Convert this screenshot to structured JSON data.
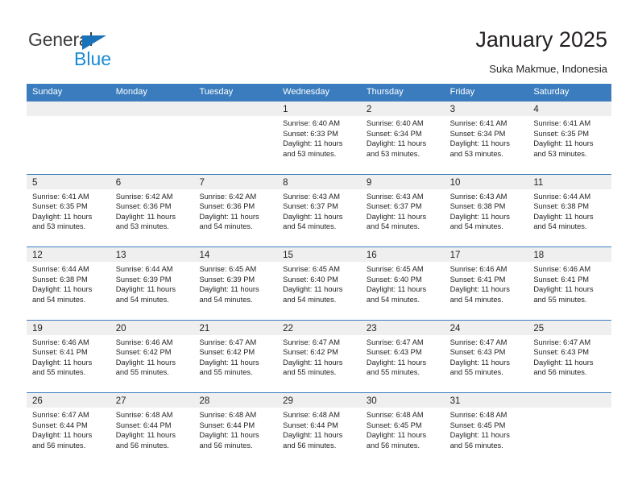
{
  "brand": {
    "name_top": "General",
    "name_bottom": "Blue"
  },
  "header": {
    "title": "January 2025",
    "subtitle": "Suka Makmue, Indonesia"
  },
  "colors": {
    "header_blue": "#3a7cbd",
    "brand_blue": "#1a8ad4",
    "day_band_gray": "#efefef",
    "text": "#231f20"
  },
  "weekdays": [
    "Sunday",
    "Monday",
    "Tuesday",
    "Wednesday",
    "Thursday",
    "Friday",
    "Saturday"
  ],
  "weeks": [
    [
      {
        "day": "",
        "sunrise": "",
        "sunset": "",
        "daylight_line1": "",
        "daylight_line2": ""
      },
      {
        "day": "",
        "sunrise": "",
        "sunset": "",
        "daylight_line1": "",
        "daylight_line2": ""
      },
      {
        "day": "",
        "sunrise": "",
        "sunset": "",
        "daylight_line1": "",
        "daylight_line2": ""
      },
      {
        "day": "1",
        "sunrise": "Sunrise: 6:40 AM",
        "sunset": "Sunset: 6:33 PM",
        "daylight_line1": "Daylight: 11 hours",
        "daylight_line2": "and 53 minutes."
      },
      {
        "day": "2",
        "sunrise": "Sunrise: 6:40 AM",
        "sunset": "Sunset: 6:34 PM",
        "daylight_line1": "Daylight: 11 hours",
        "daylight_line2": "and 53 minutes."
      },
      {
        "day": "3",
        "sunrise": "Sunrise: 6:41 AM",
        "sunset": "Sunset: 6:34 PM",
        "daylight_line1": "Daylight: 11 hours",
        "daylight_line2": "and 53 minutes."
      },
      {
        "day": "4",
        "sunrise": "Sunrise: 6:41 AM",
        "sunset": "Sunset: 6:35 PM",
        "daylight_line1": "Daylight: 11 hours",
        "daylight_line2": "and 53 minutes."
      }
    ],
    [
      {
        "day": "5",
        "sunrise": "Sunrise: 6:41 AM",
        "sunset": "Sunset: 6:35 PM",
        "daylight_line1": "Daylight: 11 hours",
        "daylight_line2": "and 53 minutes."
      },
      {
        "day": "6",
        "sunrise": "Sunrise: 6:42 AM",
        "sunset": "Sunset: 6:36 PM",
        "daylight_line1": "Daylight: 11 hours",
        "daylight_line2": "and 53 minutes."
      },
      {
        "day": "7",
        "sunrise": "Sunrise: 6:42 AM",
        "sunset": "Sunset: 6:36 PM",
        "daylight_line1": "Daylight: 11 hours",
        "daylight_line2": "and 54 minutes."
      },
      {
        "day": "8",
        "sunrise": "Sunrise: 6:43 AM",
        "sunset": "Sunset: 6:37 PM",
        "daylight_line1": "Daylight: 11 hours",
        "daylight_line2": "and 54 minutes."
      },
      {
        "day": "9",
        "sunrise": "Sunrise: 6:43 AM",
        "sunset": "Sunset: 6:37 PM",
        "daylight_line1": "Daylight: 11 hours",
        "daylight_line2": "and 54 minutes."
      },
      {
        "day": "10",
        "sunrise": "Sunrise: 6:43 AM",
        "sunset": "Sunset: 6:38 PM",
        "daylight_line1": "Daylight: 11 hours",
        "daylight_line2": "and 54 minutes."
      },
      {
        "day": "11",
        "sunrise": "Sunrise: 6:44 AM",
        "sunset": "Sunset: 6:38 PM",
        "daylight_line1": "Daylight: 11 hours",
        "daylight_line2": "and 54 minutes."
      }
    ],
    [
      {
        "day": "12",
        "sunrise": "Sunrise: 6:44 AM",
        "sunset": "Sunset: 6:38 PM",
        "daylight_line1": "Daylight: 11 hours",
        "daylight_line2": "and 54 minutes."
      },
      {
        "day": "13",
        "sunrise": "Sunrise: 6:44 AM",
        "sunset": "Sunset: 6:39 PM",
        "daylight_line1": "Daylight: 11 hours",
        "daylight_line2": "and 54 minutes."
      },
      {
        "day": "14",
        "sunrise": "Sunrise: 6:45 AM",
        "sunset": "Sunset: 6:39 PM",
        "daylight_line1": "Daylight: 11 hours",
        "daylight_line2": "and 54 minutes."
      },
      {
        "day": "15",
        "sunrise": "Sunrise: 6:45 AM",
        "sunset": "Sunset: 6:40 PM",
        "daylight_line1": "Daylight: 11 hours",
        "daylight_line2": "and 54 minutes."
      },
      {
        "day": "16",
        "sunrise": "Sunrise: 6:45 AM",
        "sunset": "Sunset: 6:40 PM",
        "daylight_line1": "Daylight: 11 hours",
        "daylight_line2": "and 54 minutes."
      },
      {
        "day": "17",
        "sunrise": "Sunrise: 6:46 AM",
        "sunset": "Sunset: 6:41 PM",
        "daylight_line1": "Daylight: 11 hours",
        "daylight_line2": "and 54 minutes."
      },
      {
        "day": "18",
        "sunrise": "Sunrise: 6:46 AM",
        "sunset": "Sunset: 6:41 PM",
        "daylight_line1": "Daylight: 11 hours",
        "daylight_line2": "and 55 minutes."
      }
    ],
    [
      {
        "day": "19",
        "sunrise": "Sunrise: 6:46 AM",
        "sunset": "Sunset: 6:41 PM",
        "daylight_line1": "Daylight: 11 hours",
        "daylight_line2": "and 55 minutes."
      },
      {
        "day": "20",
        "sunrise": "Sunrise: 6:46 AM",
        "sunset": "Sunset: 6:42 PM",
        "daylight_line1": "Daylight: 11 hours",
        "daylight_line2": "and 55 minutes."
      },
      {
        "day": "21",
        "sunrise": "Sunrise: 6:47 AM",
        "sunset": "Sunset: 6:42 PM",
        "daylight_line1": "Daylight: 11 hours",
        "daylight_line2": "and 55 minutes."
      },
      {
        "day": "22",
        "sunrise": "Sunrise: 6:47 AM",
        "sunset": "Sunset: 6:42 PM",
        "daylight_line1": "Daylight: 11 hours",
        "daylight_line2": "and 55 minutes."
      },
      {
        "day": "23",
        "sunrise": "Sunrise: 6:47 AM",
        "sunset": "Sunset: 6:43 PM",
        "daylight_line1": "Daylight: 11 hours",
        "daylight_line2": "and 55 minutes."
      },
      {
        "day": "24",
        "sunrise": "Sunrise: 6:47 AM",
        "sunset": "Sunset: 6:43 PM",
        "daylight_line1": "Daylight: 11 hours",
        "daylight_line2": "and 55 minutes."
      },
      {
        "day": "25",
        "sunrise": "Sunrise: 6:47 AM",
        "sunset": "Sunset: 6:43 PM",
        "daylight_line1": "Daylight: 11 hours",
        "daylight_line2": "and 56 minutes."
      }
    ],
    [
      {
        "day": "26",
        "sunrise": "Sunrise: 6:47 AM",
        "sunset": "Sunset: 6:44 PM",
        "daylight_line1": "Daylight: 11 hours",
        "daylight_line2": "and 56 minutes."
      },
      {
        "day": "27",
        "sunrise": "Sunrise: 6:48 AM",
        "sunset": "Sunset: 6:44 PM",
        "daylight_line1": "Daylight: 11 hours",
        "daylight_line2": "and 56 minutes."
      },
      {
        "day": "28",
        "sunrise": "Sunrise: 6:48 AM",
        "sunset": "Sunset: 6:44 PM",
        "daylight_line1": "Daylight: 11 hours",
        "daylight_line2": "and 56 minutes."
      },
      {
        "day": "29",
        "sunrise": "Sunrise: 6:48 AM",
        "sunset": "Sunset: 6:44 PM",
        "daylight_line1": "Daylight: 11 hours",
        "daylight_line2": "and 56 minutes."
      },
      {
        "day": "30",
        "sunrise": "Sunrise: 6:48 AM",
        "sunset": "Sunset: 6:45 PM",
        "daylight_line1": "Daylight: 11 hours",
        "daylight_line2": "and 56 minutes."
      },
      {
        "day": "31",
        "sunrise": "Sunrise: 6:48 AM",
        "sunset": "Sunset: 6:45 PM",
        "daylight_line1": "Daylight: 11 hours",
        "daylight_line2": "and 56 minutes."
      },
      {
        "day": "",
        "sunrise": "",
        "sunset": "",
        "daylight_line1": "",
        "daylight_line2": ""
      }
    ]
  ]
}
